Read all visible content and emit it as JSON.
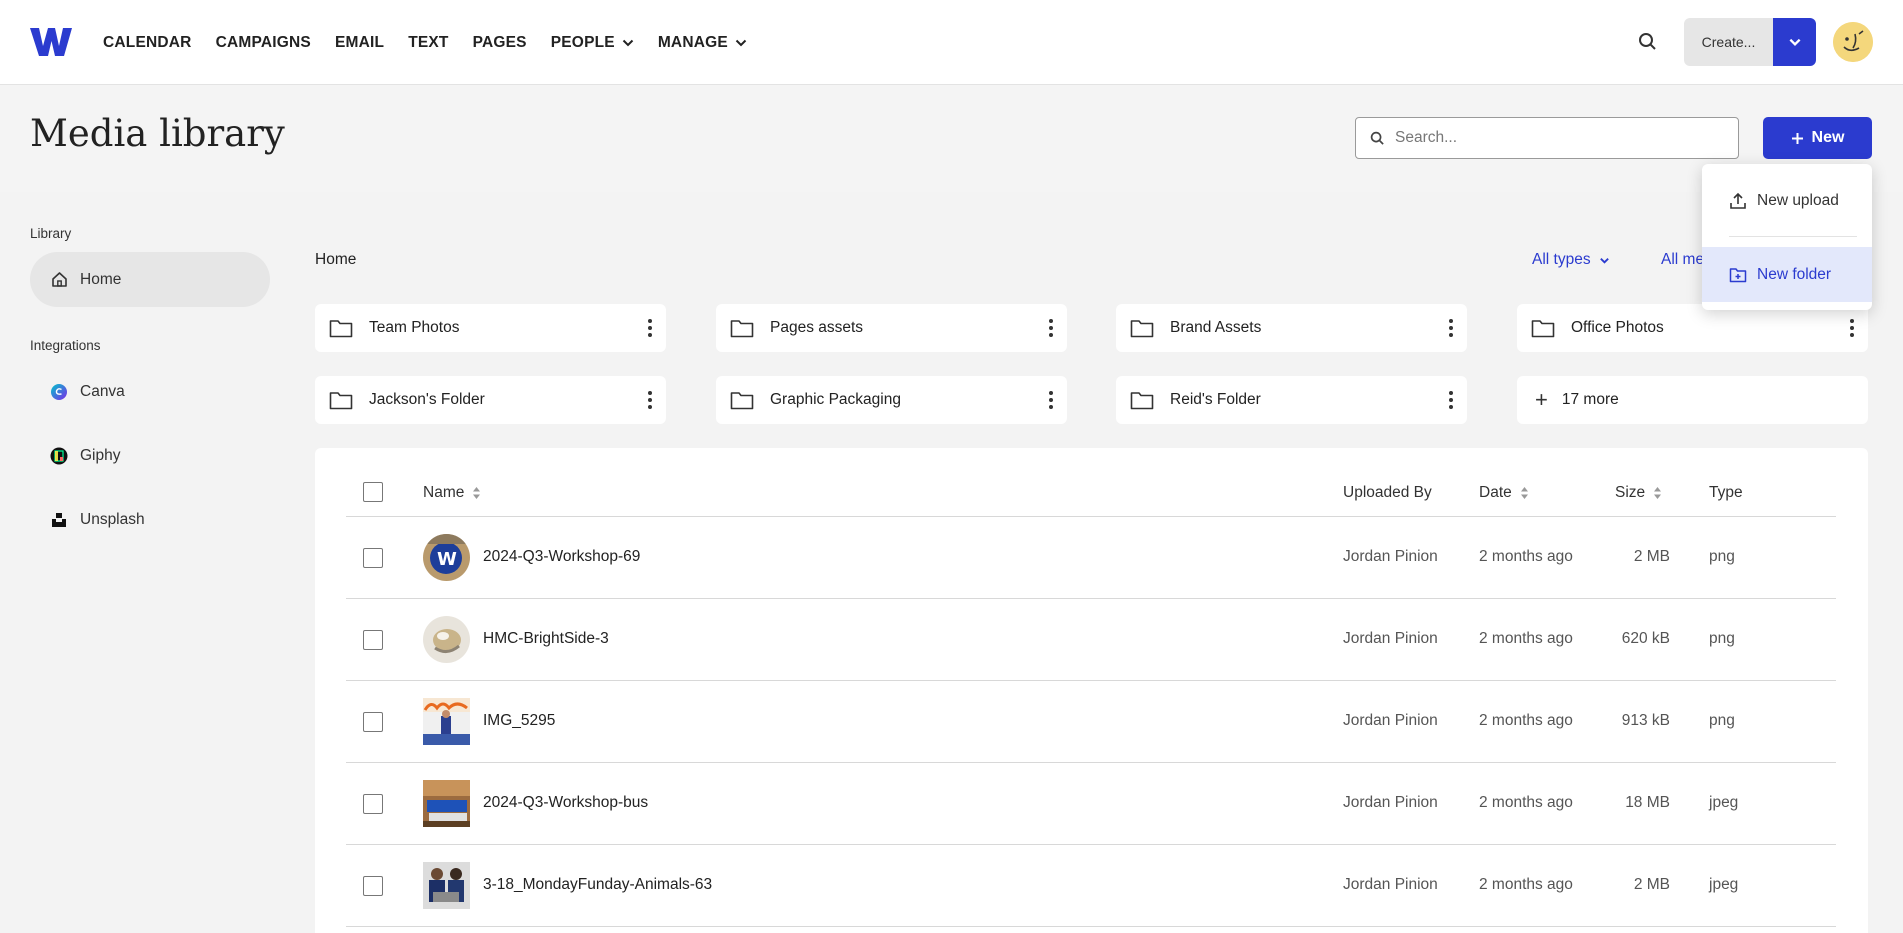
{
  "nav": {
    "links": [
      "CALENDAR",
      "CAMPAIGNS",
      "EMAIL",
      "TEXT",
      "PAGES",
      "PEOPLE",
      "MANAGE"
    ],
    "create_label": "Create...",
    "brand_color": "#2b3bcf"
  },
  "header": {
    "title": "Media library",
    "search_placeholder": "Search...",
    "new_label": "New"
  },
  "new_menu": {
    "items": [
      "New upload",
      "New folder"
    ],
    "highlighted": "New folder"
  },
  "sidebar": {
    "library_label": "Library",
    "home_label": "Home",
    "integrations_label": "Integrations",
    "integrations": [
      "Canva",
      "Giphy",
      "Unsplash"
    ]
  },
  "main": {
    "breadcrumb": "Home",
    "filters": [
      "All types",
      "All me"
    ]
  },
  "folders": [
    "Team Photos",
    "Pages assets",
    "Brand Assets",
    "Office Photos",
    "Jackson's Folder",
    "Graphic Packaging",
    "Reid's Folder"
  ],
  "more_folders": "17 more",
  "table": {
    "columns": [
      "Name",
      "Uploaded By",
      "Date",
      "Size",
      "Type"
    ],
    "rows": [
      {
        "name": "2024-Q3-Workshop-69",
        "uploaded_by": "Jordan Pinion",
        "date": "2 months ago",
        "size": "2 MB",
        "type": "png"
      },
      {
        "name": "HMC-BrightSide-3",
        "uploaded_by": "Jordan Pinion",
        "date": "2 months ago",
        "size": "620 kB",
        "type": "png"
      },
      {
        "name": "IMG_5295",
        "uploaded_by": "Jordan Pinion",
        "date": "2 months ago",
        "size": "913 kB",
        "type": "png"
      },
      {
        "name": "2024-Q3-Workshop-bus",
        "uploaded_by": "Jordan Pinion",
        "date": "2 months ago",
        "size": "18 MB",
        "type": "jpeg"
      },
      {
        "name": "3-18_MondayFunday-Animals-63",
        "uploaded_by": "Jordan Pinion",
        "date": "2 months ago",
        "size": "2 MB",
        "type": "jpeg"
      }
    ]
  }
}
